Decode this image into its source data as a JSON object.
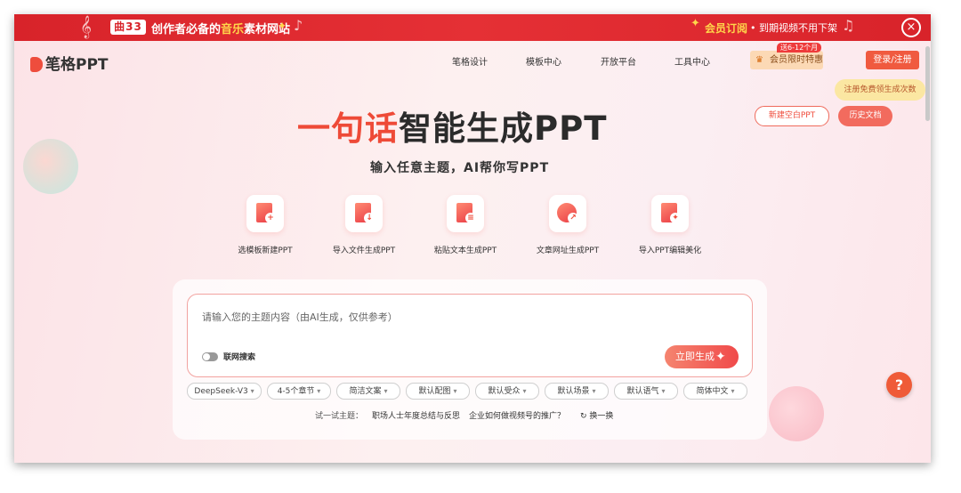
{
  "banner": {
    "logo": "曲33",
    "slogan_prefix": "创作者必备的",
    "slogan_highlight": "音乐",
    "slogan_suffix": "素材网站",
    "member_label": "会员订阅",
    "member_text": "• 到期视频不用下架",
    "close_icon": "×"
  },
  "brand": {
    "name": "笔格PPT"
  },
  "nav": {
    "items": [
      "笔格设计",
      "模板中心",
      "开放平台",
      "工具中心"
    ],
    "member_promo_tag": "送6-12个月",
    "member_button": "会员限时特惠",
    "login_button": "登录/注册",
    "tooltip": "注册免费领生成次数",
    "new_blank_button": "新建空白PPT",
    "history_button": "历史文档"
  },
  "hero": {
    "title_highlight": "一句话",
    "title_rest": "智能生成PPT",
    "subtitle": "输入任意主题，AI帮你写PPT"
  },
  "features": [
    {
      "label": "选模板新建PPT",
      "icon": "template-doc-icon"
    },
    {
      "label": "导入文件生成PPT",
      "icon": "import-file-icon"
    },
    {
      "label": "粘贴文本生成PPT",
      "icon": "paste-text-icon"
    },
    {
      "label": "文章网址生成PPT",
      "icon": "article-url-icon"
    },
    {
      "label": "导入PPT编辑美化",
      "icon": "import-ppt-icon"
    }
  ],
  "input": {
    "placeholder": "请输入您的主题内容（由AI生成，仅供参考）",
    "toggle_label": "联网搜索",
    "generate_button": "立即生成"
  },
  "options": [
    "DeepSeek-V3",
    "4-5个章节",
    "简洁文案",
    "默认配图",
    "默认受众",
    "默认场景",
    "默认语气",
    "简体中文"
  ],
  "suggestions": {
    "head": "试一试主题：",
    "items": [
      "职场人士年度总结与反思",
      "企业如何做视频号的推广？"
    ],
    "refresh": "换一换"
  },
  "help_label": "?"
}
